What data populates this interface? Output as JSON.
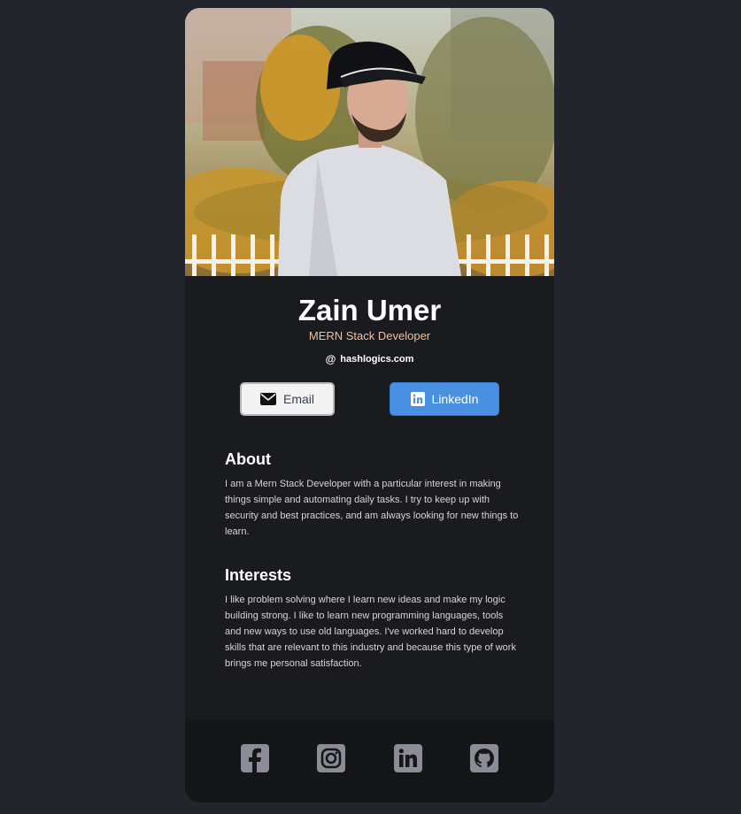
{
  "profile": {
    "name": "Zain Umer",
    "role": "MERN Stack Developer",
    "website": "hashlogics.com"
  },
  "buttons": {
    "email_label": "Email",
    "linkedin_label": "LinkedIn"
  },
  "about": {
    "heading": "About",
    "text": "I am a Mern Stack Developer with a particular interest in making things simple and automating daily tasks. I try to keep up with security and best practices, and am always looking for new things to learn."
  },
  "interests": {
    "heading": "Interests",
    "text": "I like problem solving where I learn new ideas and make my logic building strong. I like to learn new programming languages, tools and new ways to use old languages. I've worked hard to develop skills that are relevant to this industry and because this type of work brings me personal satisfaction."
  },
  "footer": {
    "icons": [
      "facebook-icon",
      "instagram-icon",
      "linkedin-icon",
      "github-icon"
    ]
  },
  "colors": {
    "page_background": "#23252c",
    "card_background": "#1a1b1f",
    "role_accent": "#f3bf99",
    "linkedin_button": "#4a90e2",
    "footer_icon": "#8c8c96"
  }
}
